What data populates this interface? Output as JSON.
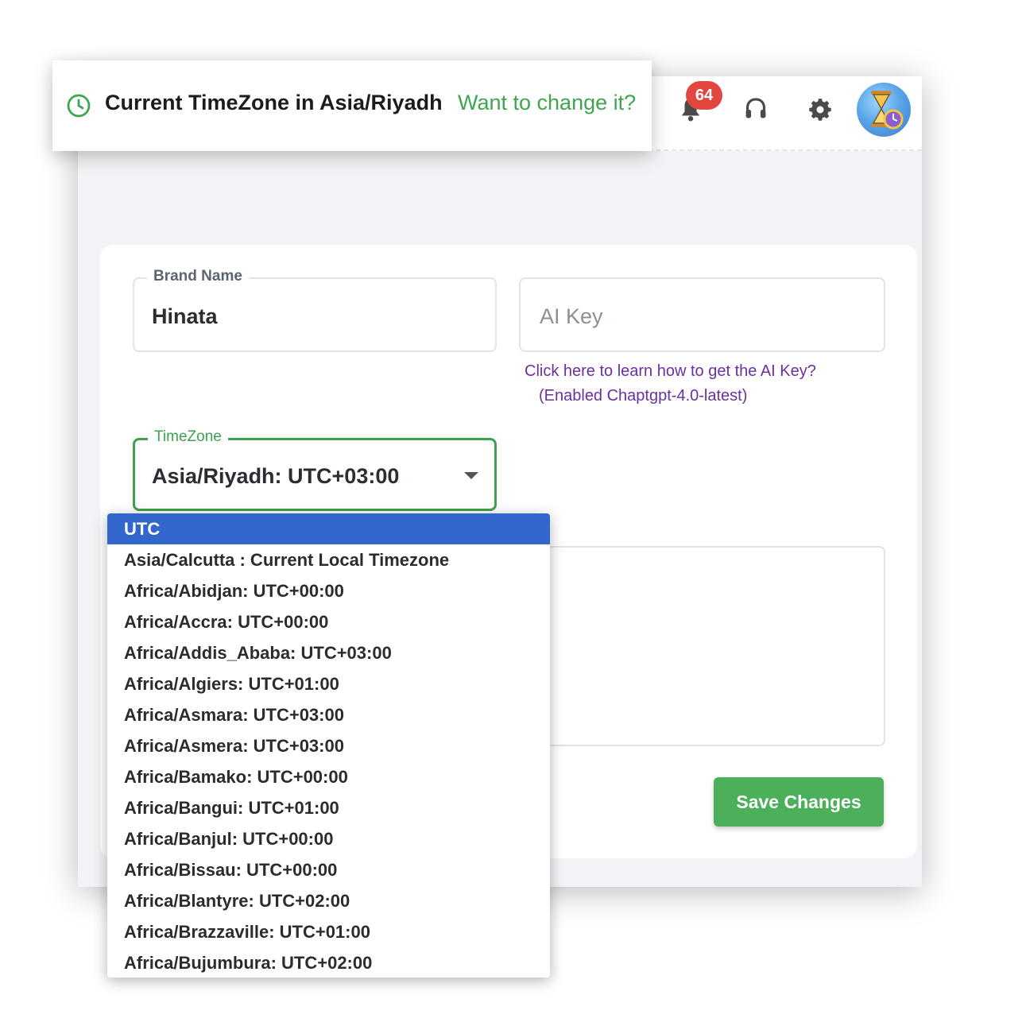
{
  "toast": {
    "title": "Current TimeZone in Asia/Riyadh",
    "link": "Want to change it?"
  },
  "header": {
    "notification_count": "64",
    "icons": [
      "bell-icon",
      "headset-icon",
      "gear-icon",
      "avatar"
    ]
  },
  "form": {
    "brand_name": {
      "label": "Brand Name",
      "value": "Hinata"
    },
    "ai_key": {
      "placeholder": "AI Key",
      "help_link": "Click here to learn how to get the AI Key?",
      "help_sub": "(Enabled Chaptgpt-4.0-latest)"
    },
    "timezone": {
      "label": "TimeZone",
      "value": "Asia/Riyadh: UTC+03:00"
    },
    "save_label": "Save Changes"
  },
  "dropdown": {
    "options": [
      "UTC",
      "Asia/Calcutta : Current Local Timezone",
      "Africa/Abidjan: UTC+00:00",
      "Africa/Accra: UTC+00:00",
      "Africa/Addis_Ababa: UTC+03:00",
      "Africa/Algiers: UTC+01:00",
      "Africa/Asmara: UTC+03:00",
      "Africa/Asmera: UTC+03:00",
      "Africa/Bamako: UTC+00:00",
      "Africa/Bangui: UTC+01:00",
      "Africa/Banjul: UTC+00:00",
      "Africa/Bissau: UTC+00:00",
      "Africa/Blantyre: UTC+02:00",
      "Africa/Brazzaville: UTC+01:00",
      "Africa/Bujumbura: UTC+02:00"
    ],
    "highlighted_index": 0
  },
  "colors": {
    "accent_green": "#3da24d",
    "save_button": "#4caf5a",
    "highlight_blue": "#3366cc",
    "badge_red": "#e2473f",
    "link_purple": "#6b2fa0"
  }
}
